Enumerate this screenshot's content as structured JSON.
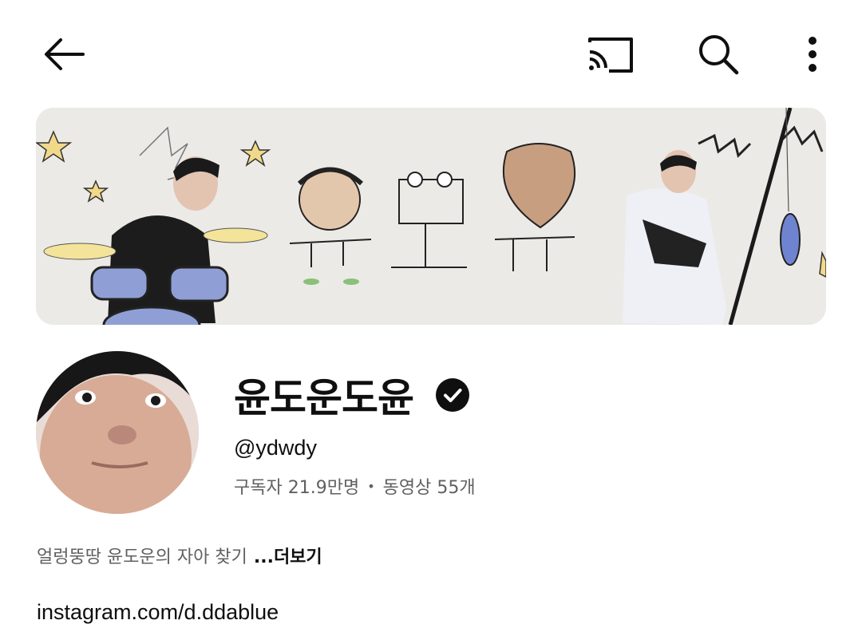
{
  "header": {
    "back_icon": "arrow-left-icon",
    "cast_icon": "cast-icon",
    "search_icon": "search-icon",
    "more_icon": "more-vert-icon"
  },
  "channel": {
    "name": "윤도운도윤",
    "verified": true,
    "handle": "@ydwdy",
    "subscribers": "구독자 21.9만명",
    "separator": "•",
    "videos": "동영상 55개",
    "description": "얼렁뚱땅 윤도운의 자아 찾기",
    "more_label": "...더보기",
    "link": "instagram.com/d.ddablue"
  },
  "colors": {
    "primary_text": "#0f0f0f",
    "secondary_text": "#606060",
    "background": "#ffffff"
  }
}
